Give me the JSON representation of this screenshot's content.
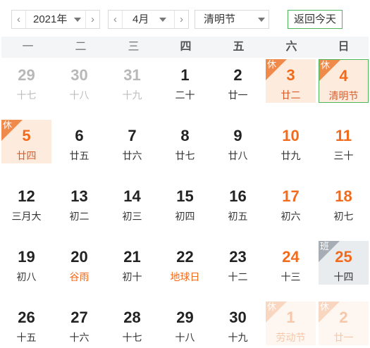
{
  "toolbar": {
    "year": {
      "value": "2021年",
      "prev": "‹",
      "next": "›"
    },
    "month": {
      "value": "4月",
      "prev": "‹",
      "next": "›"
    },
    "holiday": {
      "value": "清明节"
    },
    "today_label": "返回今天"
  },
  "weekdays": [
    "一",
    "二",
    "三",
    "四",
    "五",
    "六",
    "日"
  ],
  "badges": {
    "rest": "休",
    "work": "班"
  },
  "weeks": [
    [
      {
        "day": "29",
        "lunar": "十七",
        "type": "other"
      },
      {
        "day": "30",
        "lunar": "十八",
        "type": "other"
      },
      {
        "day": "31",
        "lunar": "十九",
        "type": "other"
      },
      {
        "day": "1",
        "lunar": "二十",
        "type": "normal"
      },
      {
        "day": "2",
        "lunar": "廿一",
        "type": "normal"
      },
      {
        "day": "3",
        "lunar": "廿二",
        "type": "rest"
      },
      {
        "day": "4",
        "lunar": "清明节",
        "type": "rest-today"
      }
    ],
    [
      {
        "day": "5",
        "lunar": "廿四",
        "type": "rest"
      },
      {
        "day": "6",
        "lunar": "廿五",
        "type": "normal"
      },
      {
        "day": "7",
        "lunar": "廿六",
        "type": "normal"
      },
      {
        "day": "8",
        "lunar": "廿七",
        "type": "normal"
      },
      {
        "day": "9",
        "lunar": "廿八",
        "type": "normal"
      },
      {
        "day": "10",
        "lunar": "廿九",
        "type": "weekend"
      },
      {
        "day": "11",
        "lunar": "三十",
        "type": "weekend"
      }
    ],
    [
      {
        "day": "12",
        "lunar": "三月大",
        "type": "normal"
      },
      {
        "day": "13",
        "lunar": "初二",
        "type": "normal"
      },
      {
        "day": "14",
        "lunar": "初三",
        "type": "normal"
      },
      {
        "day": "15",
        "lunar": "初四",
        "type": "normal"
      },
      {
        "day": "16",
        "lunar": "初五",
        "type": "normal"
      },
      {
        "day": "17",
        "lunar": "初六",
        "type": "weekend"
      },
      {
        "day": "18",
        "lunar": "初七",
        "type": "weekend"
      }
    ],
    [
      {
        "day": "19",
        "lunar": "初八",
        "type": "normal"
      },
      {
        "day": "20",
        "lunar": "谷雨",
        "type": "festival"
      },
      {
        "day": "21",
        "lunar": "初十",
        "type": "normal"
      },
      {
        "day": "22",
        "lunar": "地球日",
        "type": "festival"
      },
      {
        "day": "23",
        "lunar": "十二",
        "type": "normal"
      },
      {
        "day": "24",
        "lunar": "十三",
        "type": "weekend"
      },
      {
        "day": "25",
        "lunar": "十四",
        "type": "work"
      }
    ],
    [
      {
        "day": "26",
        "lunar": "十五",
        "type": "normal"
      },
      {
        "day": "27",
        "lunar": "十六",
        "type": "normal"
      },
      {
        "day": "28",
        "lunar": "十七",
        "type": "normal"
      },
      {
        "day": "29",
        "lunar": "十八",
        "type": "normal"
      },
      {
        "day": "30",
        "lunar": "十九",
        "type": "normal"
      },
      {
        "day": "1",
        "lunar": "劳动节",
        "type": "rest-faded"
      },
      {
        "day": "2",
        "lunar": "廿一",
        "type": "rest-faded"
      }
    ]
  ]
}
